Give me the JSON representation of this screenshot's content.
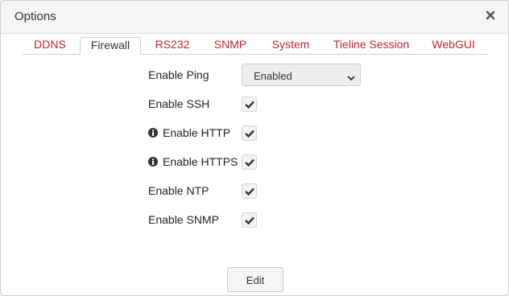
{
  "dialog": {
    "title": "Options",
    "close_icon": "close-icon"
  },
  "tabs": [
    {
      "label": "DDNS",
      "active": false
    },
    {
      "label": "Firewall",
      "active": true
    },
    {
      "label": "RS232",
      "active": false
    },
    {
      "label": "SNMP",
      "active": false
    },
    {
      "label": "System",
      "active": false
    },
    {
      "label": "Tieline Session",
      "active": false
    },
    {
      "label": "WebGUI",
      "active": false
    }
  ],
  "firewall": {
    "ping": {
      "label": "Enable Ping",
      "value": "Enabled"
    },
    "ssh": {
      "label": "Enable SSH",
      "checked": true
    },
    "http": {
      "label": "Enable HTTP",
      "checked": true,
      "icon": "info-icon"
    },
    "https": {
      "label": "Enable HTTPS",
      "checked": true,
      "icon": "info-icon"
    },
    "ntp": {
      "label": "Enable NTP",
      "checked": true
    },
    "snmp": {
      "label": "Enable SNMP",
      "checked": true
    }
  },
  "footer": {
    "edit_label": "Edit"
  },
  "colors": {
    "tab_text": "#c0272d",
    "active_tab_text": "#333333"
  }
}
